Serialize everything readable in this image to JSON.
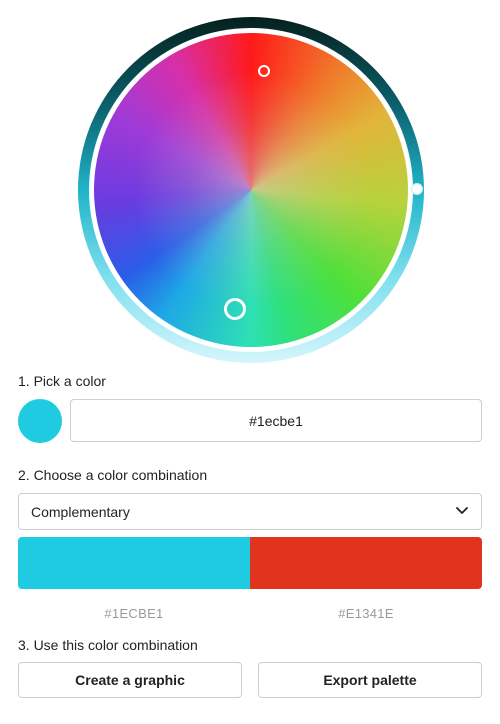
{
  "colors": {
    "primary": "#1ecbe1",
    "complement": "#e1341e"
  },
  "picker": {
    "label": "1. Pick a color",
    "hex_value": "#1ecbe1"
  },
  "combination": {
    "label": "2. Choose a color combination",
    "selected": "Complementary",
    "dropdown_icon": "chevron-down-icon",
    "swatches": [
      {
        "hex": "#1ECBE1",
        "color": "#1ecbe1"
      },
      {
        "hex": "#E1341E",
        "color": "#e1341e"
      }
    ]
  },
  "actions": {
    "label": "3. Use this color combination",
    "create_graphic": "Create a graphic",
    "export_palette": "Export palette"
  }
}
